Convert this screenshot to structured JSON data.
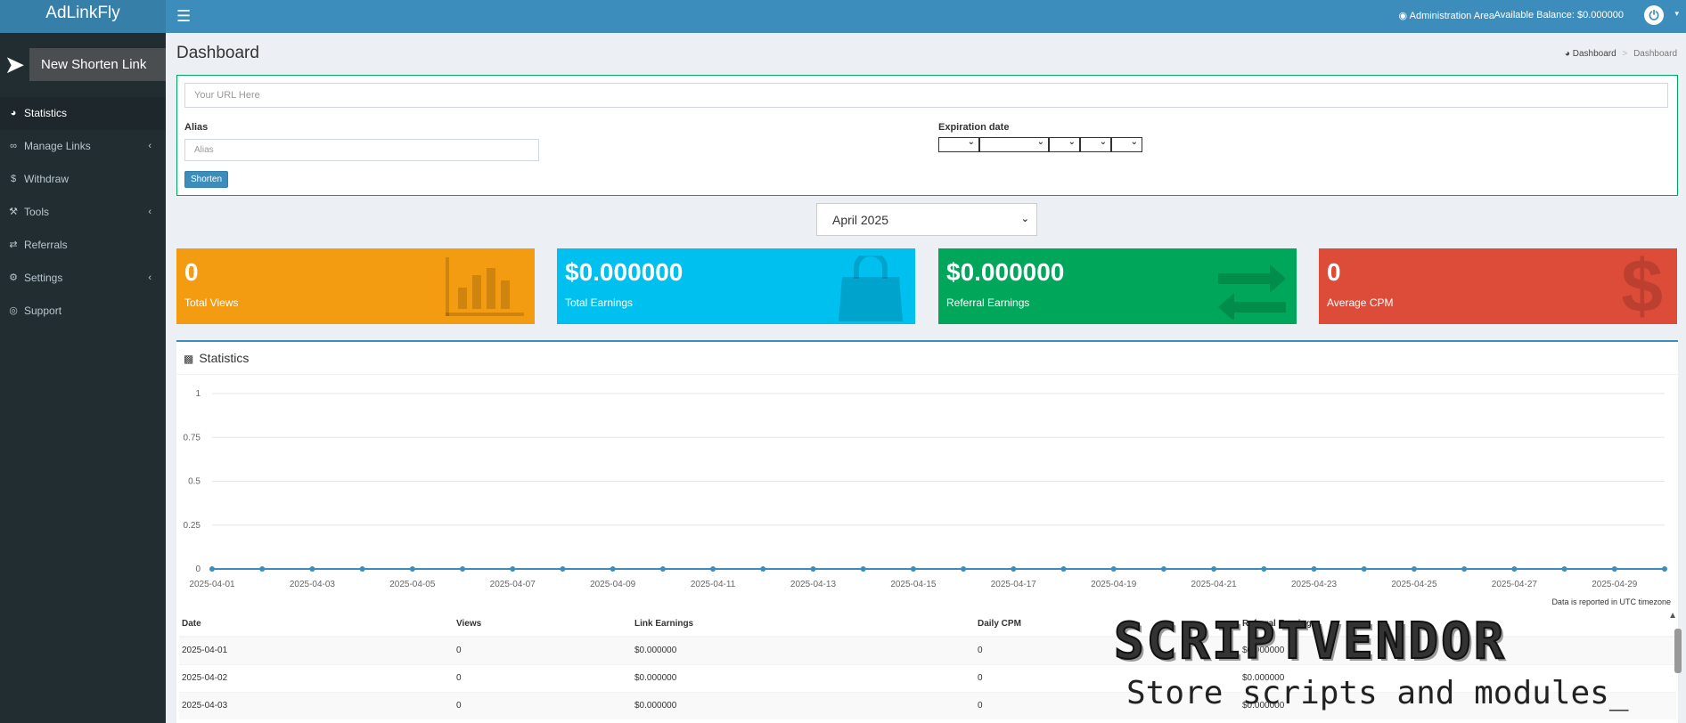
{
  "app": {
    "logo": "AdLinkFly"
  },
  "header": {
    "menu_icon": "hamburger-icon",
    "admin_area": "Administration Area",
    "balance": "Available Balance: $0.000000",
    "power_icon": "power-icon"
  },
  "sidebar": {
    "new_link": "New Shorten Link",
    "items": [
      {
        "label": "Statistics",
        "icon": "dashboard-icon",
        "active": true
      },
      {
        "label": "Manage Links",
        "icon": "link-icon",
        "submenu": true
      },
      {
        "label": "Withdraw",
        "icon": "dollar-icon"
      },
      {
        "label": "Tools",
        "icon": "wrench-icon",
        "submenu": true
      },
      {
        "label": "Referrals",
        "icon": "exchange-icon"
      },
      {
        "label": "Settings",
        "icon": "cogs-icon",
        "submenu": true
      },
      {
        "label": "Support",
        "icon": "lifebuoy-icon"
      }
    ]
  },
  "page": {
    "title": "Dashboard",
    "breadcrumb": [
      "Dashboard",
      "Dashboard"
    ]
  },
  "shorten": {
    "url_placeholder": "Your URL Here",
    "alias_label": "Alias",
    "alias_placeholder": "Alias",
    "expiration_label": "Expiration date",
    "button": "Shorten"
  },
  "month_select": {
    "value": "April 2025"
  },
  "stat_boxes": [
    {
      "value": "0",
      "label": "Total Views",
      "color": "#f39c12",
      "icon": "bar-chart-icon"
    },
    {
      "value": "$0.000000",
      "label": "Total Earnings",
      "color": "#00c0ef",
      "icon": "shopping-bag-icon"
    },
    {
      "value": "$0.000000",
      "label": "Referral Earnings",
      "color": "#00a65a",
      "icon": "exchange-icon"
    },
    {
      "value": "0",
      "label": "Average CPM",
      "color": "#dd4b39",
      "icon": "dollar-icon"
    }
  ],
  "statistics": {
    "title": "Statistics",
    "timezone_note": "Data is reported in UTC timezone",
    "table": {
      "headers": [
        "Date",
        "Views",
        "Link Earnings",
        "Daily CPM",
        "Referral Earnings"
      ],
      "rows": [
        [
          "2025-04-01",
          "0",
          "$0.000000",
          "0",
          "$0.000000"
        ],
        [
          "2025-04-02",
          "0",
          "$0.000000",
          "0",
          "$0.000000"
        ],
        [
          "2025-04-03",
          "0",
          "$0.000000",
          "0",
          "$0.000000"
        ]
      ]
    }
  },
  "chart_data": {
    "type": "line",
    "x": [
      "2025-04-01",
      "2025-04-02",
      "2025-04-03",
      "2025-04-04",
      "2025-04-05",
      "2025-04-06",
      "2025-04-07",
      "2025-04-08",
      "2025-04-09",
      "2025-04-10",
      "2025-04-11",
      "2025-04-12",
      "2025-04-13",
      "2025-04-14",
      "2025-04-15",
      "2025-04-16",
      "2025-04-17",
      "2025-04-18",
      "2025-04-19",
      "2025-04-20",
      "2025-04-21",
      "2025-04-22",
      "2025-04-23",
      "2025-04-24",
      "2025-04-25",
      "2025-04-26",
      "2025-04-27",
      "2025-04-28",
      "2025-04-29",
      "2025-04-30"
    ],
    "x_tick_labels": [
      "2025-04-01",
      "2025-04-03",
      "2025-04-05",
      "2025-04-07",
      "2025-04-09",
      "2025-04-11",
      "2025-04-13",
      "2025-04-15",
      "2025-04-17",
      "2025-04-19",
      "2025-04-21",
      "2025-04-23",
      "2025-04-25",
      "2025-04-27",
      "2025-04-29"
    ],
    "series": [
      {
        "values": [
          0,
          0,
          0,
          0,
          0,
          0,
          0,
          0,
          0,
          0,
          0,
          0,
          0,
          0,
          0,
          0,
          0,
          0,
          0,
          0,
          0,
          0,
          0,
          0,
          0,
          0,
          0,
          0,
          0,
          0
        ]
      }
    ],
    "y_ticks": [
      "1",
      "0.75",
      "0.5",
      "0.25",
      "0"
    ],
    "ylim": [
      0,
      1
    ],
    "grid": true,
    "line_color": "#3c8dbc"
  },
  "watermark": {
    "title": "SCRIPTVENDOR",
    "subtitle": "Store scripts and modules_"
  }
}
